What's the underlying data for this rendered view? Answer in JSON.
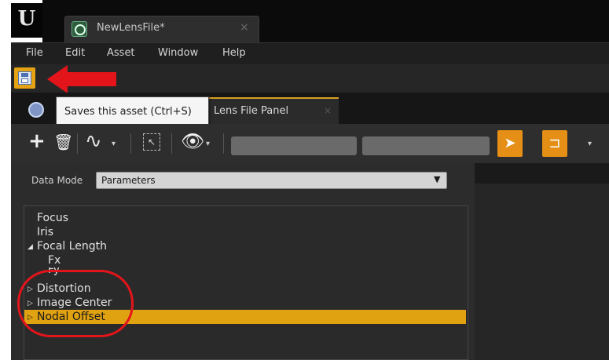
{
  "window": {
    "asset_tab_label": "NewLensFile*",
    "asset_tab_close": "×"
  },
  "menu": {
    "items": [
      "File",
      "Edit",
      "Asset",
      "Window",
      "Help"
    ]
  },
  "tooltip": {
    "text": "Saves this asset (Ctrl+S)"
  },
  "panel_tab": {
    "label": "Lens File Panel",
    "close": "×"
  },
  "data_mode": {
    "label": "Data Mode",
    "value": "Parameters"
  },
  "tree": {
    "items": [
      {
        "label": "Focus",
        "arrow": ""
      },
      {
        "label": "Iris",
        "arrow": ""
      },
      {
        "label": "Focal Length",
        "arrow": "◢"
      },
      {
        "label": "Fx",
        "arrow": ""
      },
      {
        "label": "Fy",
        "arrow": ""
      },
      {
        "label": "Distortion",
        "arrow": "▷"
      },
      {
        "label": "Image Center",
        "arrow": "▷"
      },
      {
        "label": "Nodal Offset",
        "arrow": "▷"
      }
    ],
    "selected_index": 7
  },
  "icons": {
    "logo": "unreal-logo",
    "save": "save-icon",
    "add": "plus-icon",
    "delete": "trash-icon",
    "curve": "curve-icon",
    "fit": "fit-view-icon",
    "view": "eye-icon",
    "select": "cursor-icon",
    "snap": "snap-icon"
  },
  "colors": {
    "accent": "#e1a211",
    "annotation": "#e3151b"
  }
}
